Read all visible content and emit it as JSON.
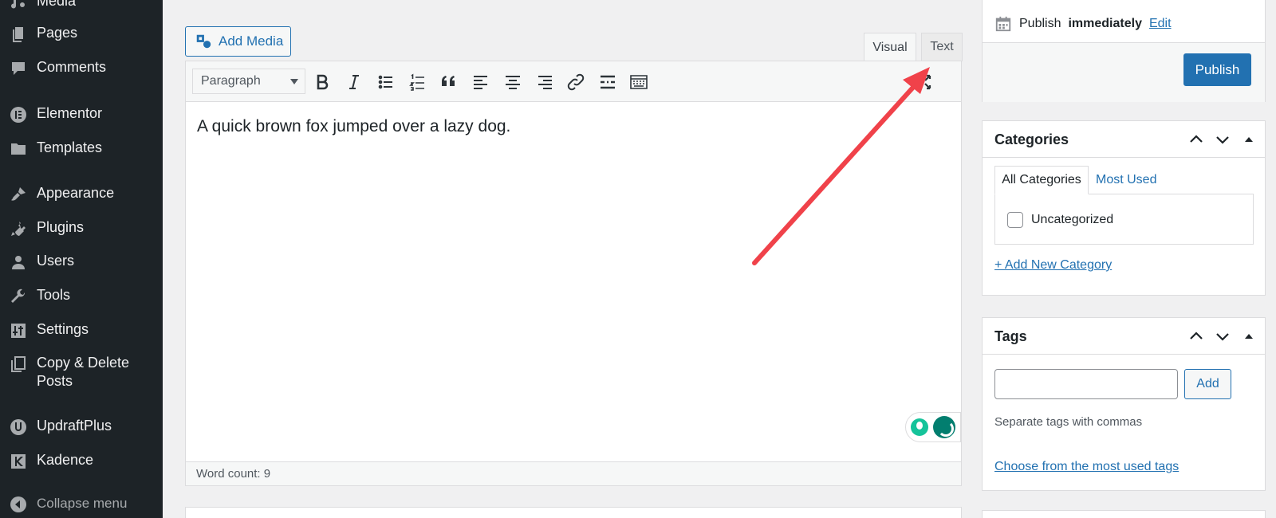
{
  "sidebar": {
    "items": [
      {
        "label": "Media",
        "icon": "media-icon"
      },
      {
        "label": "Pages",
        "icon": "pages-icon"
      },
      {
        "label": "Comments",
        "icon": "comments-icon"
      },
      {
        "label": "Elementor",
        "icon": "elementor-icon"
      },
      {
        "label": "Templates",
        "icon": "folder-icon"
      },
      {
        "label": "Appearance",
        "icon": "paintbrush-icon"
      },
      {
        "label": "Plugins",
        "icon": "plugin-icon"
      },
      {
        "label": "Users",
        "icon": "user-icon"
      },
      {
        "label": "Tools",
        "icon": "wrench-icon"
      },
      {
        "label": "Settings",
        "icon": "settings-sliders-icon"
      },
      {
        "label": "Copy & Delete Posts",
        "icon": "copy-icon"
      },
      {
        "label": "UpdraftPlus",
        "icon": "updraft-icon"
      },
      {
        "label": "Kadence",
        "icon": "kadence-icon"
      },
      {
        "label": "Collapse menu",
        "icon": "collapse-icon"
      }
    ]
  },
  "editor": {
    "add_media_label": "Add Media",
    "tab_visual": "Visual",
    "tab_text": "Text",
    "format_select": "Paragraph",
    "content": "A quick brown fox jumped over a lazy dog.",
    "word_count": "Word count: 9"
  },
  "publish": {
    "prefix": "Publish",
    "when": "immediately",
    "edit_label": "Edit",
    "button_label": "Publish"
  },
  "categories": {
    "title": "Categories",
    "tab_all": "All Categories",
    "tab_most_used": "Most Used",
    "items": [
      "Uncategorized"
    ],
    "add_new": "+ Add New Category"
  },
  "tags": {
    "title": "Tags",
    "input_value": "",
    "add_label": "Add",
    "hint": "Separate tags with commas",
    "choose_link": "Choose from the most used tags"
  },
  "colors": {
    "sidebar_bg": "#1d2327",
    "accent": "#2271b1",
    "arrow": "#f0424a",
    "grammarly": "#15c39a"
  }
}
